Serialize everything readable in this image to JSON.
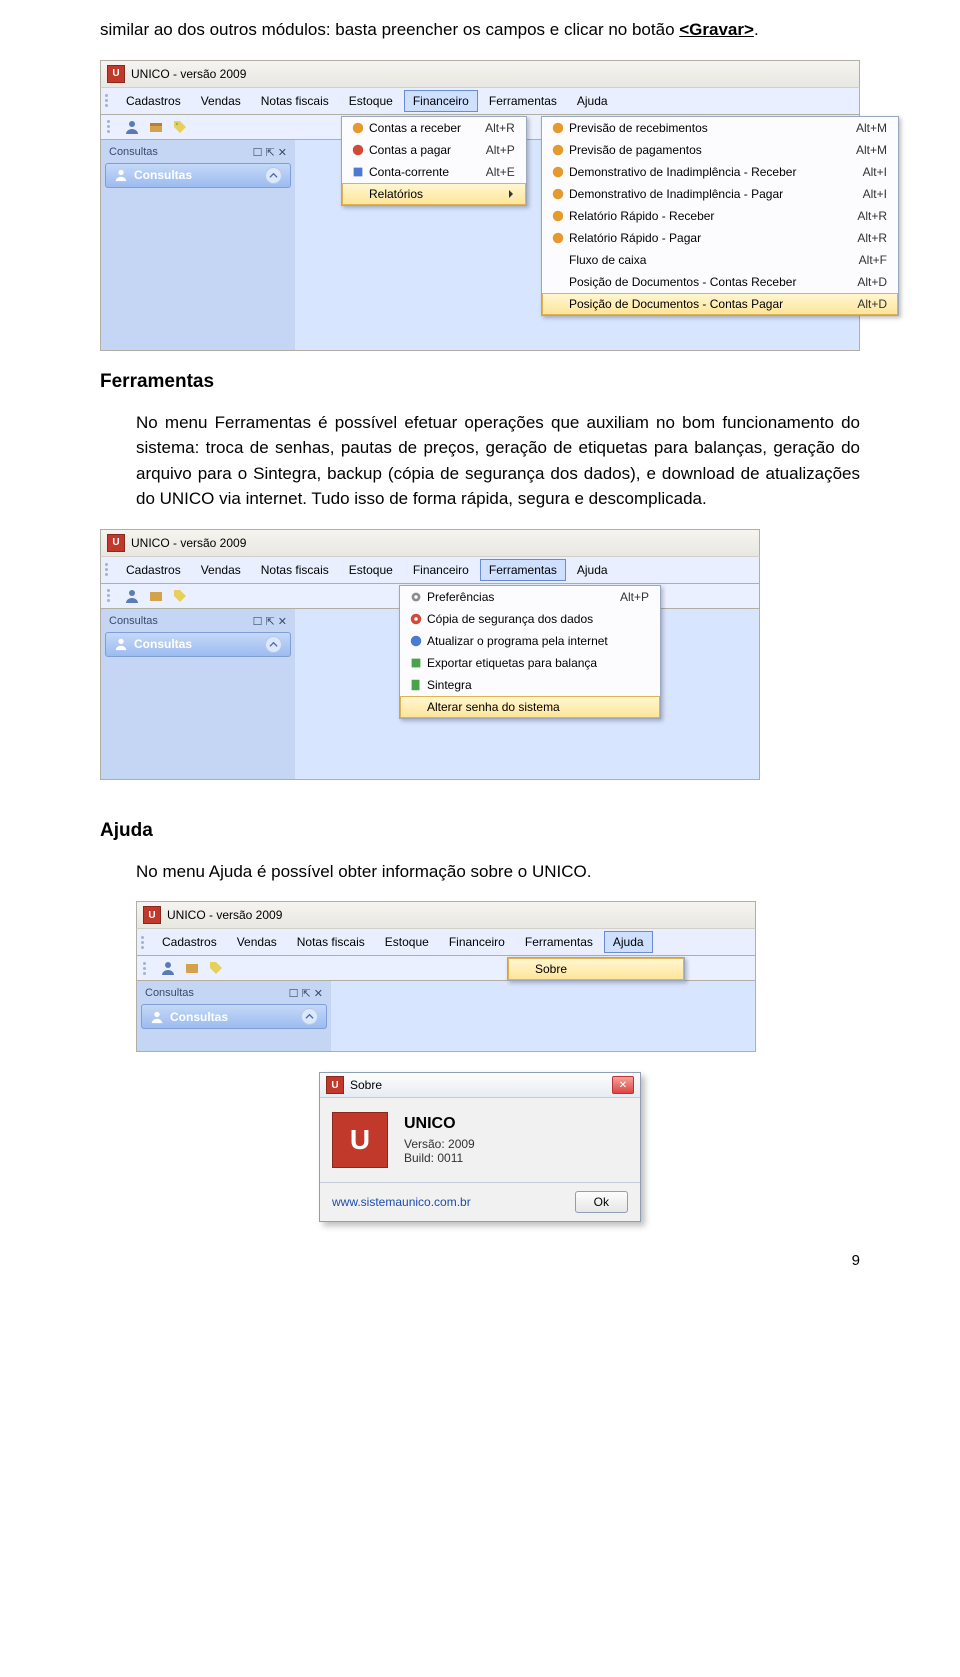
{
  "intro_para": "similar ao dos outros módulos: basta preencher os campos e clicar no botão ",
  "intro_button": "<Gravar>",
  "intro_period": ".",
  "win1": {
    "title": "UNICO - versão 2009",
    "menubar": [
      "Cadastros",
      "Vendas",
      "Notas fiscais",
      "Estoque",
      "Financeiro",
      "Ferramentas",
      "Ajuda"
    ],
    "open_index": 4,
    "side_label": "Consultas",
    "side_head": "Consultas",
    "menu_items": [
      {
        "icon": "orange",
        "label": "Contas a receber",
        "shortcut": "Alt+R"
      },
      {
        "icon": "red",
        "label": "Contas a pagar",
        "shortcut": "Alt+P"
      },
      {
        "icon": "blue",
        "label": "Conta-corrente",
        "shortcut": "Alt+E"
      },
      {
        "icon": "",
        "label": "Relatórios",
        "arrow": true,
        "hover": true
      }
    ],
    "submenu_items": [
      {
        "icon": "orange",
        "label": "Previsão de recebimentos",
        "shortcut": "Alt+M"
      },
      {
        "icon": "orange",
        "label": "Previsão de pagamentos",
        "shortcut": "Alt+M"
      },
      {
        "icon": "orange",
        "label": "Demonstrativo de Inadimplência - Receber",
        "shortcut": "Alt+I"
      },
      {
        "icon": "orange",
        "label": "Demonstrativo de Inadimplência - Pagar",
        "shortcut": "Alt+I"
      },
      {
        "icon": "orange",
        "label": "Relatório Rápido - Receber",
        "shortcut": "Alt+R"
      },
      {
        "icon": "orange",
        "label": "Relatório Rápido - Pagar",
        "shortcut": "Alt+R"
      },
      {
        "icon": "",
        "label": "Fluxo de caixa",
        "shortcut": "Alt+F"
      },
      {
        "icon": "",
        "label": "Posição de Documentos - Contas Receber",
        "shortcut": "Alt+D"
      },
      {
        "icon": "",
        "label": "Posição de Documentos - Contas Pagar",
        "shortcut": "Alt+D",
        "hover": true
      }
    ]
  },
  "ferramentas": {
    "heading": "Ferramentas",
    "para": "No menu Ferramentas é possível efetuar operações que auxiliam no bom funcionamento do sistema: troca de senhas, pautas de preços, geração de etiquetas para balanças, geração do arquivo para o Sintegra, backup (cópia de segurança dos dados), e download de atualizações do UNICO via internet. Tudo isso de forma rápida, segura e descomplicada."
  },
  "win2": {
    "title": "UNICO - versão 2009",
    "menubar": [
      "Cadastros",
      "Vendas",
      "Notas fiscais",
      "Estoque",
      "Financeiro",
      "Ferramentas",
      "Ajuda"
    ],
    "open_index": 5,
    "side_label": "Consultas",
    "side_head": "Consultas",
    "menu_items": [
      {
        "icon": "gray",
        "label": "Preferências",
        "shortcut": "Alt+P"
      },
      {
        "icon": "red",
        "label": "Cópia de segurança dos dados"
      },
      {
        "icon": "blue",
        "label": "Atualizar o programa pela internet"
      },
      {
        "icon": "green",
        "label": "Exportar etiquetas para balança"
      },
      {
        "icon": "green",
        "label": "Sintegra"
      },
      {
        "icon": "",
        "label": "Alterar senha do sistema",
        "hover": true
      }
    ]
  },
  "ajuda": {
    "heading": "Ajuda",
    "para": "No menu Ajuda é possível obter informação sobre o UNICO."
  },
  "win3": {
    "title": "UNICO - versão 2009",
    "menubar": [
      "Cadastros",
      "Vendas",
      "Notas fiscais",
      "Estoque",
      "Financeiro",
      "Ferramentas",
      "Ajuda"
    ],
    "open_index": 6,
    "side_label": "Consultas",
    "side_head": "Consultas",
    "menu_items": [
      {
        "icon": "",
        "label": "Sobre",
        "hover": true
      }
    ]
  },
  "about": {
    "title": "Sobre",
    "name": "UNICO",
    "version": "Versão: 2009",
    "build": "Build: 0011",
    "site": "www.sistemaunico.com.br",
    "ok": "Ok"
  },
  "page_number": "9"
}
